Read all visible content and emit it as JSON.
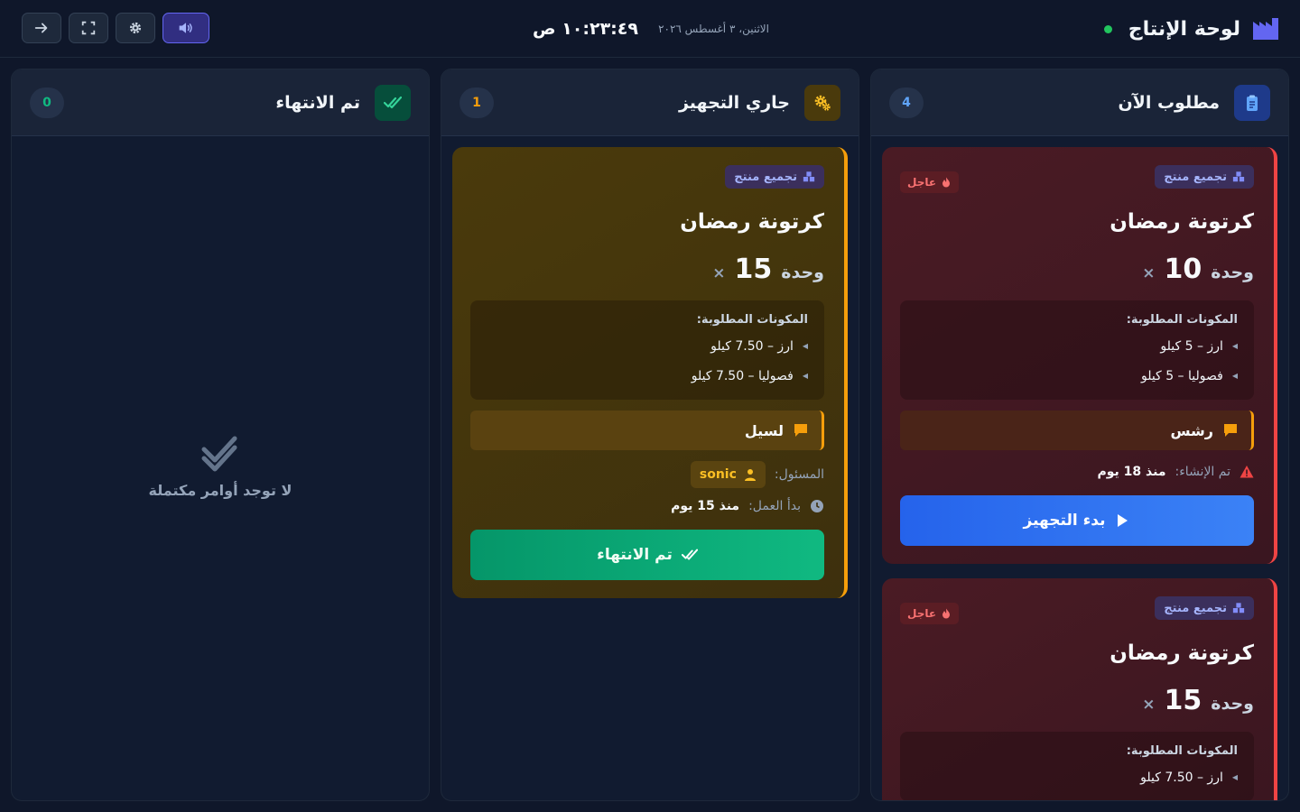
{
  "header": {
    "title": "لوحة الإنتاج",
    "time": "١٠:٢٣:٤٩ ص",
    "date": "الاثنين، ٣ أغسطس ٢٠٢٦",
    "status_color": "#22c55e",
    "controls": [
      {
        "icon": "arrow-right-icon"
      },
      {
        "icon": "fullscreen-icon"
      },
      {
        "icon": "gear-icon"
      },
      {
        "icon": "volume-icon",
        "active": true
      }
    ]
  },
  "columns": {
    "todo": {
      "title": "مطلوب الآن",
      "count": "4",
      "icon": "clipboard-icon",
      "accent": "#3b82f6",
      "cards": [
        {
          "tag": "تجميع منتج",
          "urgent": "عاجل",
          "product": "كرتونة رمضان",
          "qty_x": "×",
          "qty": "10",
          "unit": "وحدة",
          "ingredients_title": "المكونات المطلوبة:",
          "ingredients": [
            "ارز – 5 كيلو",
            "فصوليا – 5 كيلو"
          ],
          "note": "رشس",
          "created_label": "تم الإنشاء:",
          "created_value": "منذ 18 يوم",
          "action": "بدء التجهيز"
        },
        {
          "tag": "تجميع منتج",
          "urgent": "عاجل",
          "product": "كرتونة رمضان",
          "qty_x": "×",
          "qty": "15",
          "unit": "وحدة",
          "ingredients_title": "المكونات المطلوبة:",
          "ingredients": [
            "ارز – 7.50 كيلو"
          ]
        }
      ]
    },
    "in_progress": {
      "title": "جاري التجهيز",
      "count": "1",
      "icon": "gears-icon",
      "accent": "#f59e0b",
      "cards": [
        {
          "tag": "تجميع منتج",
          "product": "كرتونة رمضان",
          "qty_x": "×",
          "qty": "15",
          "unit": "وحدة",
          "ingredients_title": "المكونات المطلوبة:",
          "ingredients": [
            "ارز – 7.50 كيلو",
            "فصوليا – 7.50 كيلو"
          ],
          "note": "لسيل",
          "assignee_label": "المسئول:",
          "assignee": "sonic",
          "started_label": "بدأ العمل:",
          "started_value": "منذ 15 يوم",
          "action": "تم الانتهاء"
        }
      ]
    },
    "done": {
      "title": "تم الانتهاء",
      "count": "0",
      "icon": "double-check-icon",
      "accent": "#10b981",
      "empty_text": "لا توجد أوامر مكتملة"
    }
  }
}
